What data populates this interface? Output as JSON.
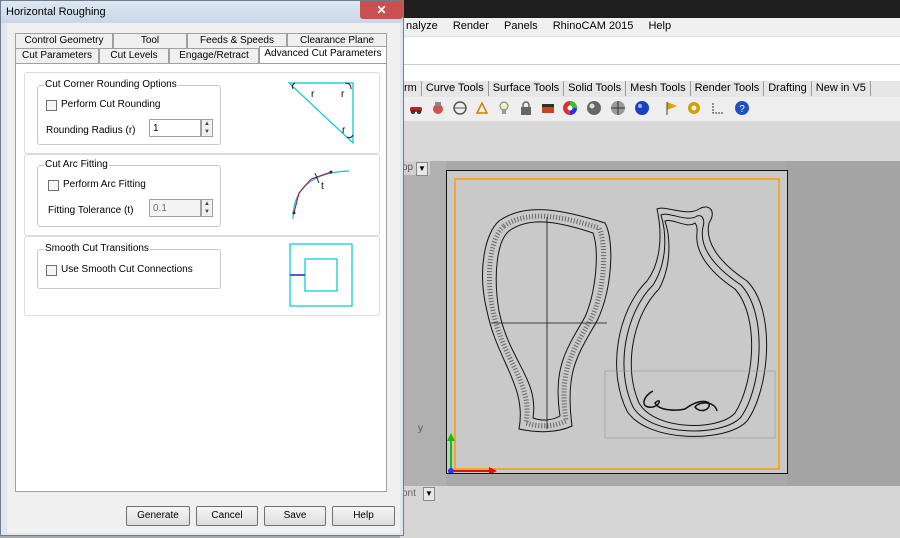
{
  "dialog": {
    "title": "Horizontal Roughing",
    "close_glyph": "✕",
    "tabs_row1": [
      "Control Geometry",
      "Tool",
      "Feeds & Speeds",
      "Clearance Plane"
    ],
    "tabs_row2": [
      "Cut Parameters",
      "Cut Levels",
      "Engage/Retract",
      "Advanced Cut Parameters"
    ],
    "active_tab": "Advanced Cut Parameters",
    "corner": {
      "title": "Cut Corner Rounding Options",
      "checkbox_label": "Perform Cut Rounding",
      "checked": false,
      "radius_label": "Rounding Radius (r)",
      "radius_value": "1",
      "diagram_label": "r"
    },
    "arc": {
      "title": "Cut Arc Fitting",
      "checkbox_label": "Perform Arc Fitting",
      "checked": false,
      "tolerance_label": "Fitting Tolerance (t)",
      "tolerance_value": "0.1",
      "diagram_label": "t"
    },
    "smooth": {
      "title": "Smooth Cut Transitions",
      "checkbox_label": "Use Smooth Cut Connections",
      "checked": false
    },
    "buttons": {
      "generate": "Generate",
      "cancel": "Cancel",
      "save": "Save",
      "help": "Help"
    }
  },
  "app": {
    "menu": [
      "nalyze",
      "Render",
      "Panels",
      "RhinoCAM 2015",
      "Help"
    ],
    "toolbar_tabs": [
      "rm",
      "Curve Tools",
      "Surface Tools",
      "Solid Tools",
      "Mesh Tools",
      "Render Tools",
      "Drafting",
      "New in V5"
    ],
    "viewport_label": "op",
    "viewport2_label": "ont",
    "axis_y_label": "y",
    "colors": {
      "accent": "#ff9900",
      "x_axis": "#e01010",
      "y_axis": "#10c010",
      "diagram": "#00c8d8"
    }
  }
}
